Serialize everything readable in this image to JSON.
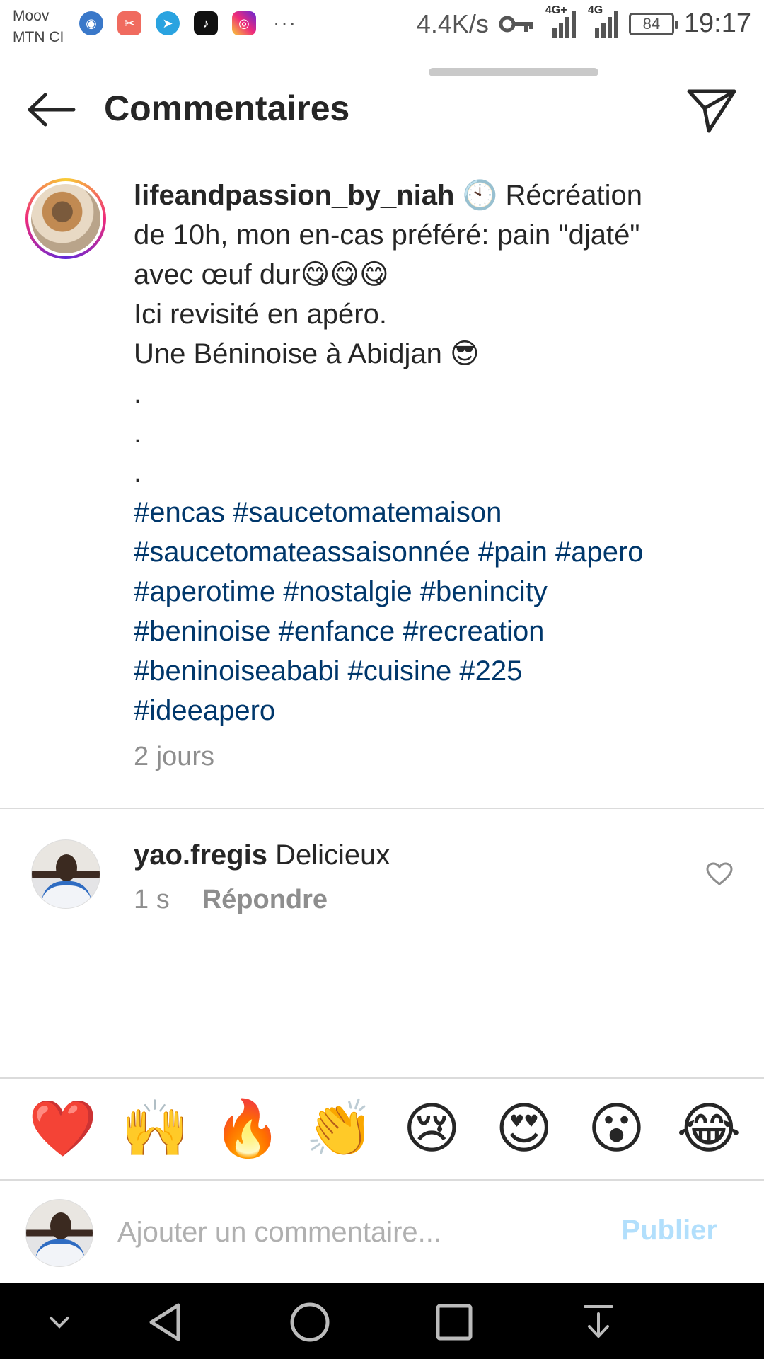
{
  "status_bar": {
    "carrier_1": "Moov",
    "carrier_2": "MTN CI",
    "net_speed": "4.4K/s",
    "signal_1": "4G+",
    "signal_2": "4G",
    "battery": "84",
    "time": "19:17",
    "more": "···"
  },
  "header": {
    "title": "Commentaires"
  },
  "caption": {
    "username": "lifeandpassion_by_niah",
    "lines": [
      "🕙 Récréation",
      "de 10h, mon en-cas préféré: pain \"djaté\"",
      "avec œuf dur😋😋😋",
      "Ici revisité en apéro.",
      "Une Béninoise à Abidjan 😎",
      ".",
      ".",
      "."
    ],
    "hashtag_lines": [
      "#encas #saucetomatemaison",
      "#saucetomateassaisonnée #pain #apero",
      "#aperotime #nostalgie #benincity",
      "#beninoise #enfance #recreation",
      "#beninoiseababi #cuisine #225",
      "#ideeapero"
    ],
    "time": "2 jours"
  },
  "comment": {
    "username": "yao.fregis",
    "text": "Delicieux",
    "time": "1 s",
    "reply_label": "Répondre"
  },
  "emoji_bar": [
    "❤️",
    "🙌",
    "🔥",
    "👏",
    "😢",
    "😍",
    "😮",
    "😂"
  ],
  "input": {
    "placeholder": "Ajouter un commentaire...",
    "publish_label": "Publier"
  },
  "colors": {
    "hashtag": "#00376b",
    "secondary_text": "#8e8e8e",
    "publish_disabled": "#b2dffc",
    "navbar": "#000000"
  }
}
